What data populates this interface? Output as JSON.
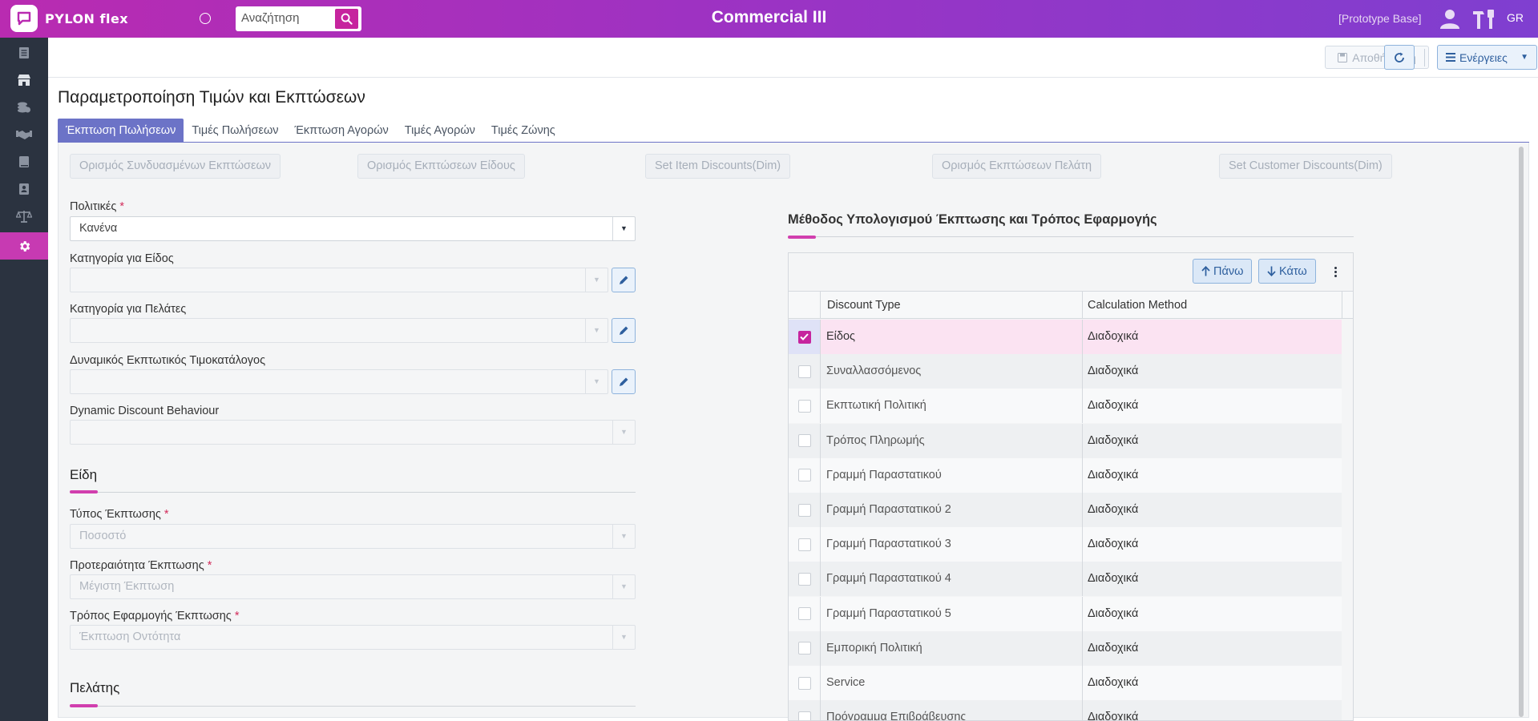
{
  "topbar": {
    "logo_text": "PYLON flex",
    "search_placeholder": "Αναζήτηση",
    "app_title": "Commercial III",
    "base_label": "[Prototype Base]",
    "language": "GR"
  },
  "sidebar": {
    "items": [
      {
        "icon": "document-icon"
      },
      {
        "icon": "store-icon"
      },
      {
        "icon": "coins-icon"
      },
      {
        "icon": "handshake-icon"
      },
      {
        "icon": "book-icon"
      },
      {
        "icon": "contacts-icon"
      },
      {
        "icon": "scale-icon"
      },
      {
        "icon": "gear-icon",
        "active": true
      }
    ]
  },
  "toolbar": {
    "save_label": "Αποθήκευση",
    "actions_label": "Ενέργειες"
  },
  "page": {
    "title": "Παραμετροποίηση Τιμών και Εκπτώσεων"
  },
  "tabs": [
    {
      "label": "Έκπτωση Πωλήσεων",
      "active": true
    },
    {
      "label": "Τιμές Πωλήσεων"
    },
    {
      "label": "Έκπτωση Αγορών"
    },
    {
      "label": "Τιμές Αγορών"
    },
    {
      "label": "Τιμές Ζώνης"
    }
  ],
  "action_buttons": [
    "Ορισμός Συνδυασμένων Εκπτώσεων",
    "Ορισμός Εκπτώσεων Είδους",
    "Set Item Discounts(Dim)",
    "Ορισμός Εκπτώσεων Πελάτη",
    "Set Customer Discounts(Dim)"
  ],
  "form": {
    "policies": {
      "label": "Πολιτικές",
      "value": "Κανένα"
    },
    "item_category": {
      "label": "Κατηγορία για Είδος",
      "value": ""
    },
    "customer_category": {
      "label": "Κατηγορία για Πελάτες",
      "value": ""
    },
    "dynamic_pricelist": {
      "label": "Δυναμικός Εκπτωτικός Τιμοκατάλογος",
      "value": ""
    },
    "dynamic_behaviour": {
      "label": "Dynamic Discount Behaviour",
      "value": ""
    },
    "items_section": "Είδη",
    "discount_type": {
      "label": "Τύπος Έκπτωσης",
      "value": "Ποσοστό"
    },
    "discount_priority": {
      "label": "Προτεραιότητα Έκπτωσης",
      "value": "Μέγιστη Έκπτωση"
    },
    "discount_apply": {
      "label": "Τρόπος Εφαρμογής Έκπτωσης",
      "value": "Έκπτωση Οντότητα"
    },
    "customer_section": "Πελάτης"
  },
  "right_panel": {
    "title": "Μέθοδος Υπολογισμού Έκπτωσης και Τρόπος Εφαρμογής",
    "up_label": "Πάνω",
    "down_label": "Κάτω",
    "columns": [
      "Discount Type",
      "Calculation Method"
    ],
    "rows": [
      {
        "type": "Είδος",
        "method": "Διαδοχικά",
        "checked": true
      },
      {
        "type": "Συναλλασσόμενος",
        "method": "Διαδοχικά"
      },
      {
        "type": "Εκπτωτική Πολιτική",
        "method": "Διαδοχικά"
      },
      {
        "type": "Τρόπος Πληρωμής",
        "method": "Διαδοχικά"
      },
      {
        "type": "Γραμμή Παραστατικού",
        "method": "Διαδοχικά"
      },
      {
        "type": "Γραμμή Παραστατικού 2",
        "method": "Διαδοχικά"
      },
      {
        "type": "Γραμμή Παραστατικού 3",
        "method": "Διαδοχικά"
      },
      {
        "type": "Γραμμή Παραστατικού 4",
        "method": "Διαδοχικά"
      },
      {
        "type": "Γραμμή Παραστατικού 5",
        "method": "Διαδοχικά"
      },
      {
        "type": "Εμπορική Πολιτική",
        "method": "Διαδοχικά"
      },
      {
        "type": "Service",
        "method": "Διαδοχικά"
      },
      {
        "type": "Πρόγραμμα Επιβράβευσης",
        "method": "Διαδοχικά"
      }
    ]
  },
  "colors": {
    "accent": "#c6249e",
    "tab_active": "#6c73c7",
    "sidebar_bg": "#2b3340"
  }
}
